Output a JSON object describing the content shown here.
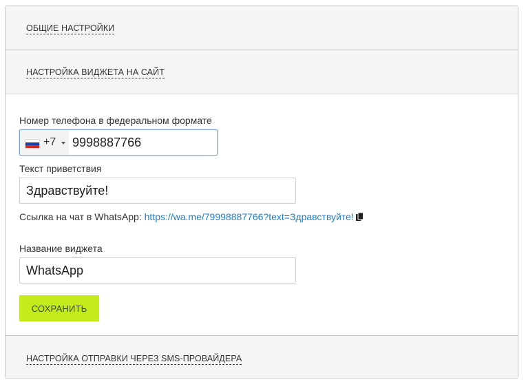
{
  "sections": {
    "general_settings": "ОБЩИЕ НАСТРОЙКИ",
    "widget_settings": "НАСТРОЙКА ВИДЖЕТА НА САЙТ",
    "sms_settings": "НАСТРОЙКА ОТПРАВКИ ЧЕРЕЗ SMS-ПРОВАЙДЕРА"
  },
  "form": {
    "phone_label": "Номер телефона в федеральном формате",
    "country": {
      "flag_icon": "russia-flag-icon",
      "dial_code": "+7"
    },
    "phone_value": "9998887766",
    "greeting_label": "Текст приветствия",
    "greeting_value": "Здравствуйте!",
    "link_prefix": "Ссылка на чат в WhatsApp: ",
    "link_url": "https://wa.me/79998887766?text=Здравствуйте!",
    "copy_icon": "copy-icon",
    "widget_name_label": "Название виджета",
    "widget_name_value": "WhatsApp",
    "save_label": "СОХРАНИТЬ"
  },
  "colors": {
    "accent_button": "#c3ea1b",
    "link": "#1a7fcf",
    "focus_border": "#7ea4d4"
  }
}
